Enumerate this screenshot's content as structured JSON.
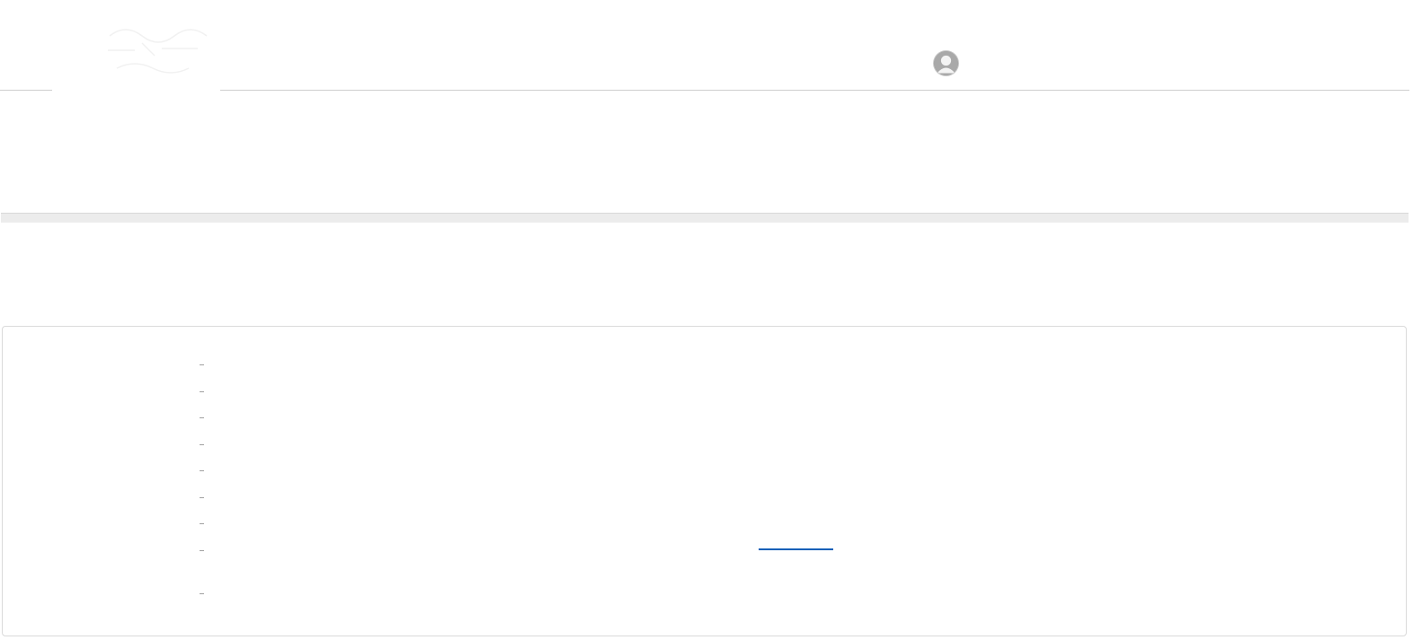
{
  "header": {
    "logo_icon": "faded-logo-icon",
    "avatar_icon": "user-avatar-icon"
  },
  "colors": {
    "divider": "#cfcfcf",
    "band": "#ececec",
    "panel_border": "#dadada",
    "bullet": "#a0a0a0",
    "link": "#0f5fb8",
    "avatar": "#9e9e9e"
  },
  "panel": {
    "items": [
      {
        "label": ""
      },
      {
        "label": ""
      },
      {
        "label": ""
      },
      {
        "label": ""
      },
      {
        "label": ""
      },
      {
        "label": ""
      },
      {
        "label": ""
      },
      {
        "label": ""
      },
      {
        "label": ""
      }
    ],
    "link_text": ""
  }
}
